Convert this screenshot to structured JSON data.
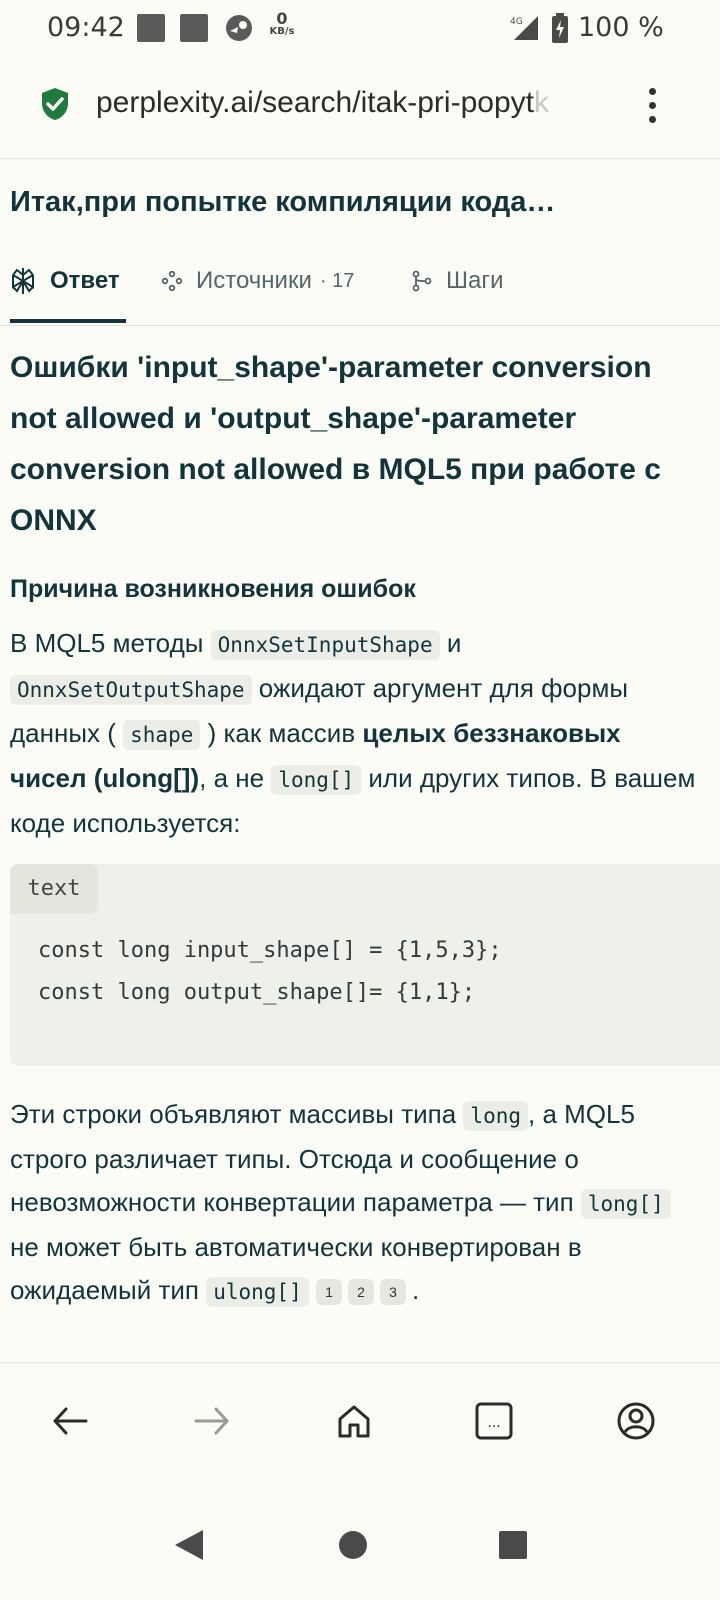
{
  "status_bar": {
    "time": "09:42",
    "net_speed_value": "0",
    "net_speed_unit": "KB/s",
    "network_type": "4G",
    "battery_percent": "100 %"
  },
  "browser": {
    "url_visible": "perplexity.ai/search/itak-pri-popyt",
    "url_faded": "k",
    "secure_icon": "shield-check-icon",
    "menu_icon": "kebab-menu-icon"
  },
  "page": {
    "title": "Итак,при попытке компиляции кода…"
  },
  "tabs": {
    "answer": "Ответ",
    "sources": "Источники",
    "sources_count": "· 17",
    "steps": "Шаги"
  },
  "answer": {
    "heading": "Ошибки 'input_shape'-parameter conversion not allowed и 'output_shape'-parameter conversion not allowed в MQL5 при работе с ONNX",
    "section_title": "Причина возникновения ошибок",
    "p1": {
      "t1": "В MQL5 методы ",
      "c1": "OnnxSetInputShape",
      "t2": " и ",
      "c2": "OnnxSetOutputShape",
      "t3": " ожидают аргумент для формы данных ( ",
      "c3": "shape",
      "t4": " ) как массив ",
      "b1": "целых беззнаковых чисел (ulong[])",
      "t5": ", а не ",
      "c4": "long[]",
      "t6": " или других типов. В вашем коде используется:"
    },
    "code": {
      "lang": "text",
      "line1": "const long input_shape[] = {1,5,3};",
      "line2": "const long output_shape[]= {1,1};"
    },
    "p2": {
      "t1": "Эти строки объявляют массивы типа ",
      "c1": "long",
      "t2": ", а MQL5 строго различает типы. Отсюда и сообщение о невозможности конвертации параметра — тип ",
      "c2": "long[]",
      "t3": " не может быть автоматически конвертирован в ожидаемый тип ",
      "c3": "ulong[]",
      "cite1": "1",
      "cite2": "2",
      "cite3": "3",
      "t4": "."
    }
  },
  "bottom_nav": [
    "back-arrow-icon",
    "forward-arrow-icon",
    "home-icon",
    "tabs-icon",
    "account-icon"
  ],
  "tabs_button_label": "...",
  "system_nav": [
    "back-triangle-icon",
    "home-circle-icon",
    "recents-square-icon"
  ]
}
